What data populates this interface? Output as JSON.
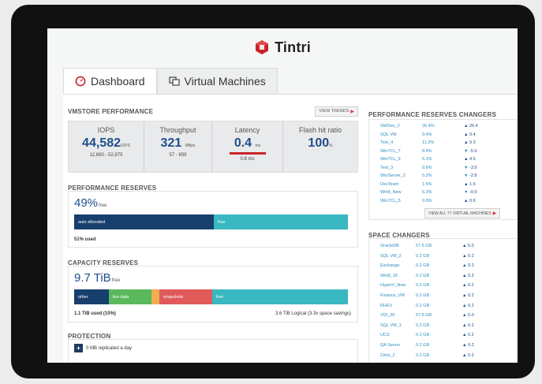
{
  "brand": {
    "name": "Tintri",
    "logo_icon": "tintri-logo-icon"
  },
  "tabs": [
    {
      "label": "Dashboard",
      "icon": "gauge-icon",
      "active": true
    },
    {
      "label": "Virtual Machines",
      "icon": "vm-windows-icon",
      "active": false
    }
  ],
  "vmstore": {
    "title": "VMSTORE PERFORMANCE",
    "view_trends": "VIEW TRENDS",
    "metrics": [
      {
        "label": "IOPS",
        "value": "44,582",
        "unit": "IOPS",
        "sub": "12,690 - 52,875"
      },
      {
        "label": "Throughput",
        "value": "321",
        "unit": "MBps",
        "sub": "57 - 659"
      },
      {
        "label": "Latency",
        "value": "0.4",
        "unit": "ms",
        "sub": "0.8 ms"
      },
      {
        "label": "Flash hit ratio",
        "value": "100",
        "unit": "%",
        "sub": ""
      }
    ]
  },
  "perf_reserves": {
    "title": "PERFORMANCE RESERVES",
    "value": "49%",
    "value_suffix": "free",
    "auto_label": "auto allocated",
    "free_label": "free",
    "used_pct": 51,
    "used_text": "51% used",
    "colors": {
      "auto": "#173f6e",
      "free": "#39b8c1"
    }
  },
  "capacity": {
    "title": "CAPACITY RESERVES",
    "value": "9.7 TiB",
    "value_suffix": "free",
    "segments": [
      {
        "label": "other",
        "pct": 12.6,
        "color": "#173f6e"
      },
      {
        "label": "live data",
        "pct": 15.5,
        "color": "#5cb85c"
      },
      {
        "label": "",
        "pct": 3,
        "color": "#f0ad4e"
      },
      {
        "label": "snapshots",
        "pct": 19.3,
        "color": "#e05a5a"
      },
      {
        "label": "free",
        "pct": 49.6,
        "color": "#39b8c1"
      }
    ],
    "used_text": "1.1 TiB used (10%)",
    "logical_text": "3.6 TiB Logical (3.3x space savings)"
  },
  "protection": {
    "title": "PROTECTION",
    "row_text": "0 MB replicated a day",
    "plus": "+"
  },
  "perf_changers": {
    "title": "PERFORMANCE RESERVES CHANGERS",
    "rows": [
      {
        "name": "SWDev_2",
        "pct": "26.4%",
        "dir": "up",
        "delta": "26.4"
      },
      {
        "name": "SQL VM",
        "pct": "9.4%",
        "dir": "up",
        "delta": "9.4"
      },
      {
        "name": "Test_4",
        "pct": "11.2%",
        "dir": "up",
        "delta": "9.3"
      },
      {
        "name": "Win7CL_7",
        "pct": "8.6%",
        "dir": "dn",
        "delta": "-5.9"
      },
      {
        "name": "Win7CL_9",
        "pct": "6.1%",
        "dir": "up",
        "delta": "4.5"
      },
      {
        "name": "Test_3",
        "pct": "0.6%",
        "dir": "dn",
        "delta": "-3.9"
      },
      {
        "name": "WinServer_2",
        "pct": "0.2%",
        "dir": "dn",
        "delta": "-2.8"
      },
      {
        "name": "DevTeam",
        "pct": "1.5%",
        "dir": "up",
        "delta": "1.5"
      },
      {
        "name": "Win8_New",
        "pct": "6.3%",
        "dir": "dn",
        "delta": "-0.9"
      },
      {
        "name": "Win7CL_5",
        "pct": "0.6%",
        "dir": "up",
        "delta": "0.6"
      }
    ],
    "view_all": "VIEW ALL 77 VIRTUAL MACHINES"
  },
  "space_changers": {
    "title": "SPACE CHANGERS",
    "rows": [
      {
        "name": "OracleDB",
        "size": "57.5 GB",
        "delta": "5.0"
      },
      {
        "name": "SQL VM_2",
        "size": "0.2 GB",
        "delta": "0.2"
      },
      {
        "name": "Exchange",
        "size": "0.2 GB",
        "delta": "0.2"
      },
      {
        "name": "Win8_18",
        "size": "0.2 GB",
        "delta": "0.2"
      },
      {
        "name": "HyperV_New",
        "size": "0.2 GB",
        "delta": "0.2"
      },
      {
        "name": "Finance_VM",
        "size": "0.2 GB",
        "delta": "0.2"
      },
      {
        "name": "RHEV",
        "size": "0.2 GB",
        "delta": "0.2"
      },
      {
        "name": "VDI_20",
        "size": "57.5 GB",
        "delta": "5.0"
      },
      {
        "name": "SQL VM_1",
        "size": "0.2 GB",
        "delta": "0.2"
      },
      {
        "name": "UCS",
        "size": "0.2 GB",
        "delta": "0.2"
      },
      {
        "name": "QA Server",
        "size": "0.2 GB",
        "delta": "0.2"
      },
      {
        "name": "Citrix_2",
        "size": "0.2 GB",
        "delta": "0.2"
      }
    ]
  }
}
